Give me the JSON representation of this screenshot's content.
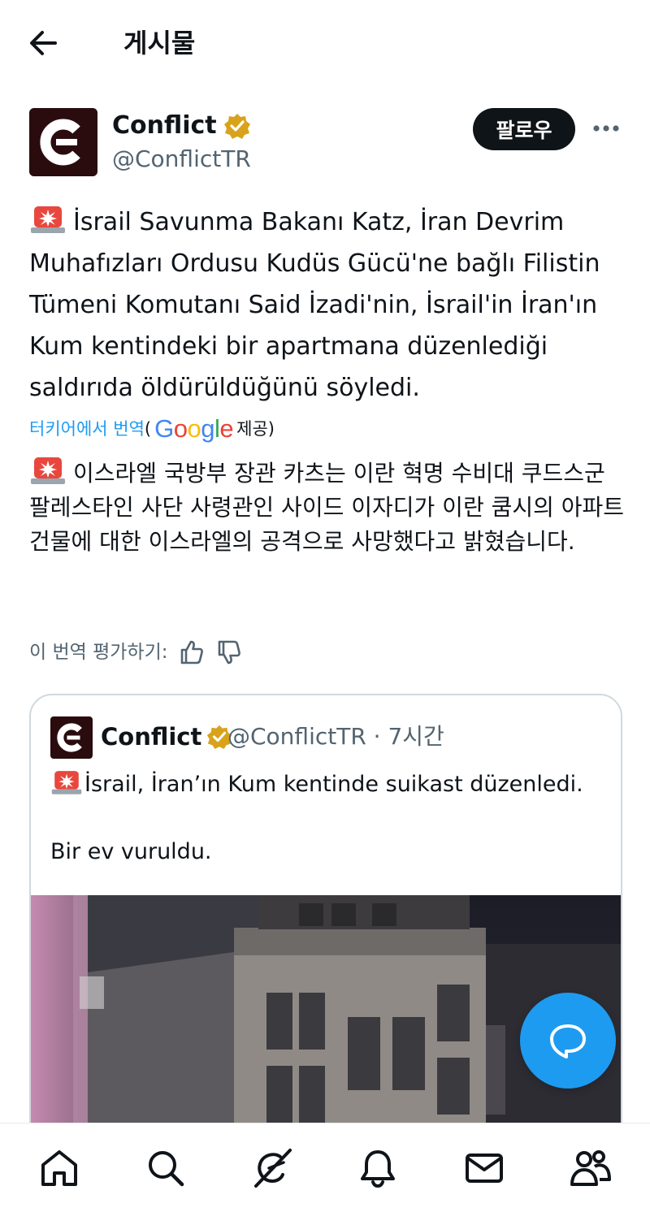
{
  "header": {
    "title": "게시물",
    "back_icon": "arrow-left-icon"
  },
  "author": {
    "name": "Conflict",
    "handle": "@ConflictTR",
    "verified": true,
    "verified_color": "#d8a31a"
  },
  "follow_label": "팔로우",
  "tweet": {
    "text": "İsrail Savunma Bakanı Katz, İran Devrim Muhafızları Ordusu Kudüs Gücü'ne bağlı Filistin Tümeni Komutanı Said İzadi'nin, İsrail'in İran'ın Kum kentindeki bir apartmana düzenlediği saldırıda öldürüldüğünü söyledi.",
    "emoji_icon": "siren-icon"
  },
  "translation": {
    "link_label": "터키어에서 번역",
    "open_paren": "(",
    "provider": "Google",
    "provided_label": " 제공)",
    "text": "이스라엘 국방부 장관 카츠는 이란 혁명 수비대 쿠드스군 팔레스타인 사단 사령관인 사이드 이자디가 이란 쿰시의 아파트 건물에 대한 이스라엘의 공격으로 사망했다고 밝혔습니다.",
    "rate_label": "이 번역 평가하기:"
  },
  "quoted": {
    "name": "Conflict",
    "handle_time": "@ConflictTR · 7시간",
    "text_line1": "İsrail, İran’ın Kum kentinde suikast düzenledi.",
    "text_line2": "Bir ev vuruldu."
  },
  "colors": {
    "accent": "#1d9bf0",
    "text": "#0f1419",
    "muted": "#536471"
  },
  "nav_items": [
    "home-icon",
    "search-icon",
    "grok-icon",
    "notifications-icon",
    "messages-icon",
    "communities-icon"
  ]
}
